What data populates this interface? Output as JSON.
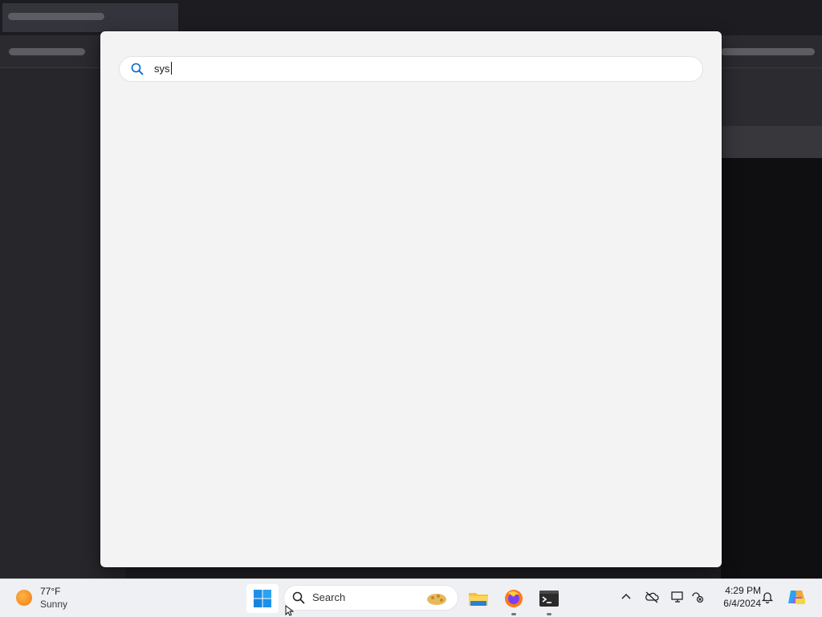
{
  "search_flyout": {
    "query": "sys"
  },
  "taskbar": {
    "weather": {
      "temperature": "77°F",
      "condition": "Sunny"
    },
    "search_label": "Search",
    "pinned_apps": [
      "start-windows-icon",
      "file-explorer-icon",
      "firefox-icon",
      "terminal-icon"
    ],
    "tray_icons": [
      "chevron-up-icon",
      "onedrive-offline-icon",
      "network-display-icon",
      "accessibility-status-icon",
      "notification-bell-icon",
      "copilot-pre-icon"
    ],
    "clock": {
      "time": "4:29 PM",
      "date": "6/4/2024"
    }
  },
  "colors": {
    "accent": "#0067c0",
    "flyout_bg": "#f3f3f3",
    "taskbar_bg": "#eef0f4"
  }
}
